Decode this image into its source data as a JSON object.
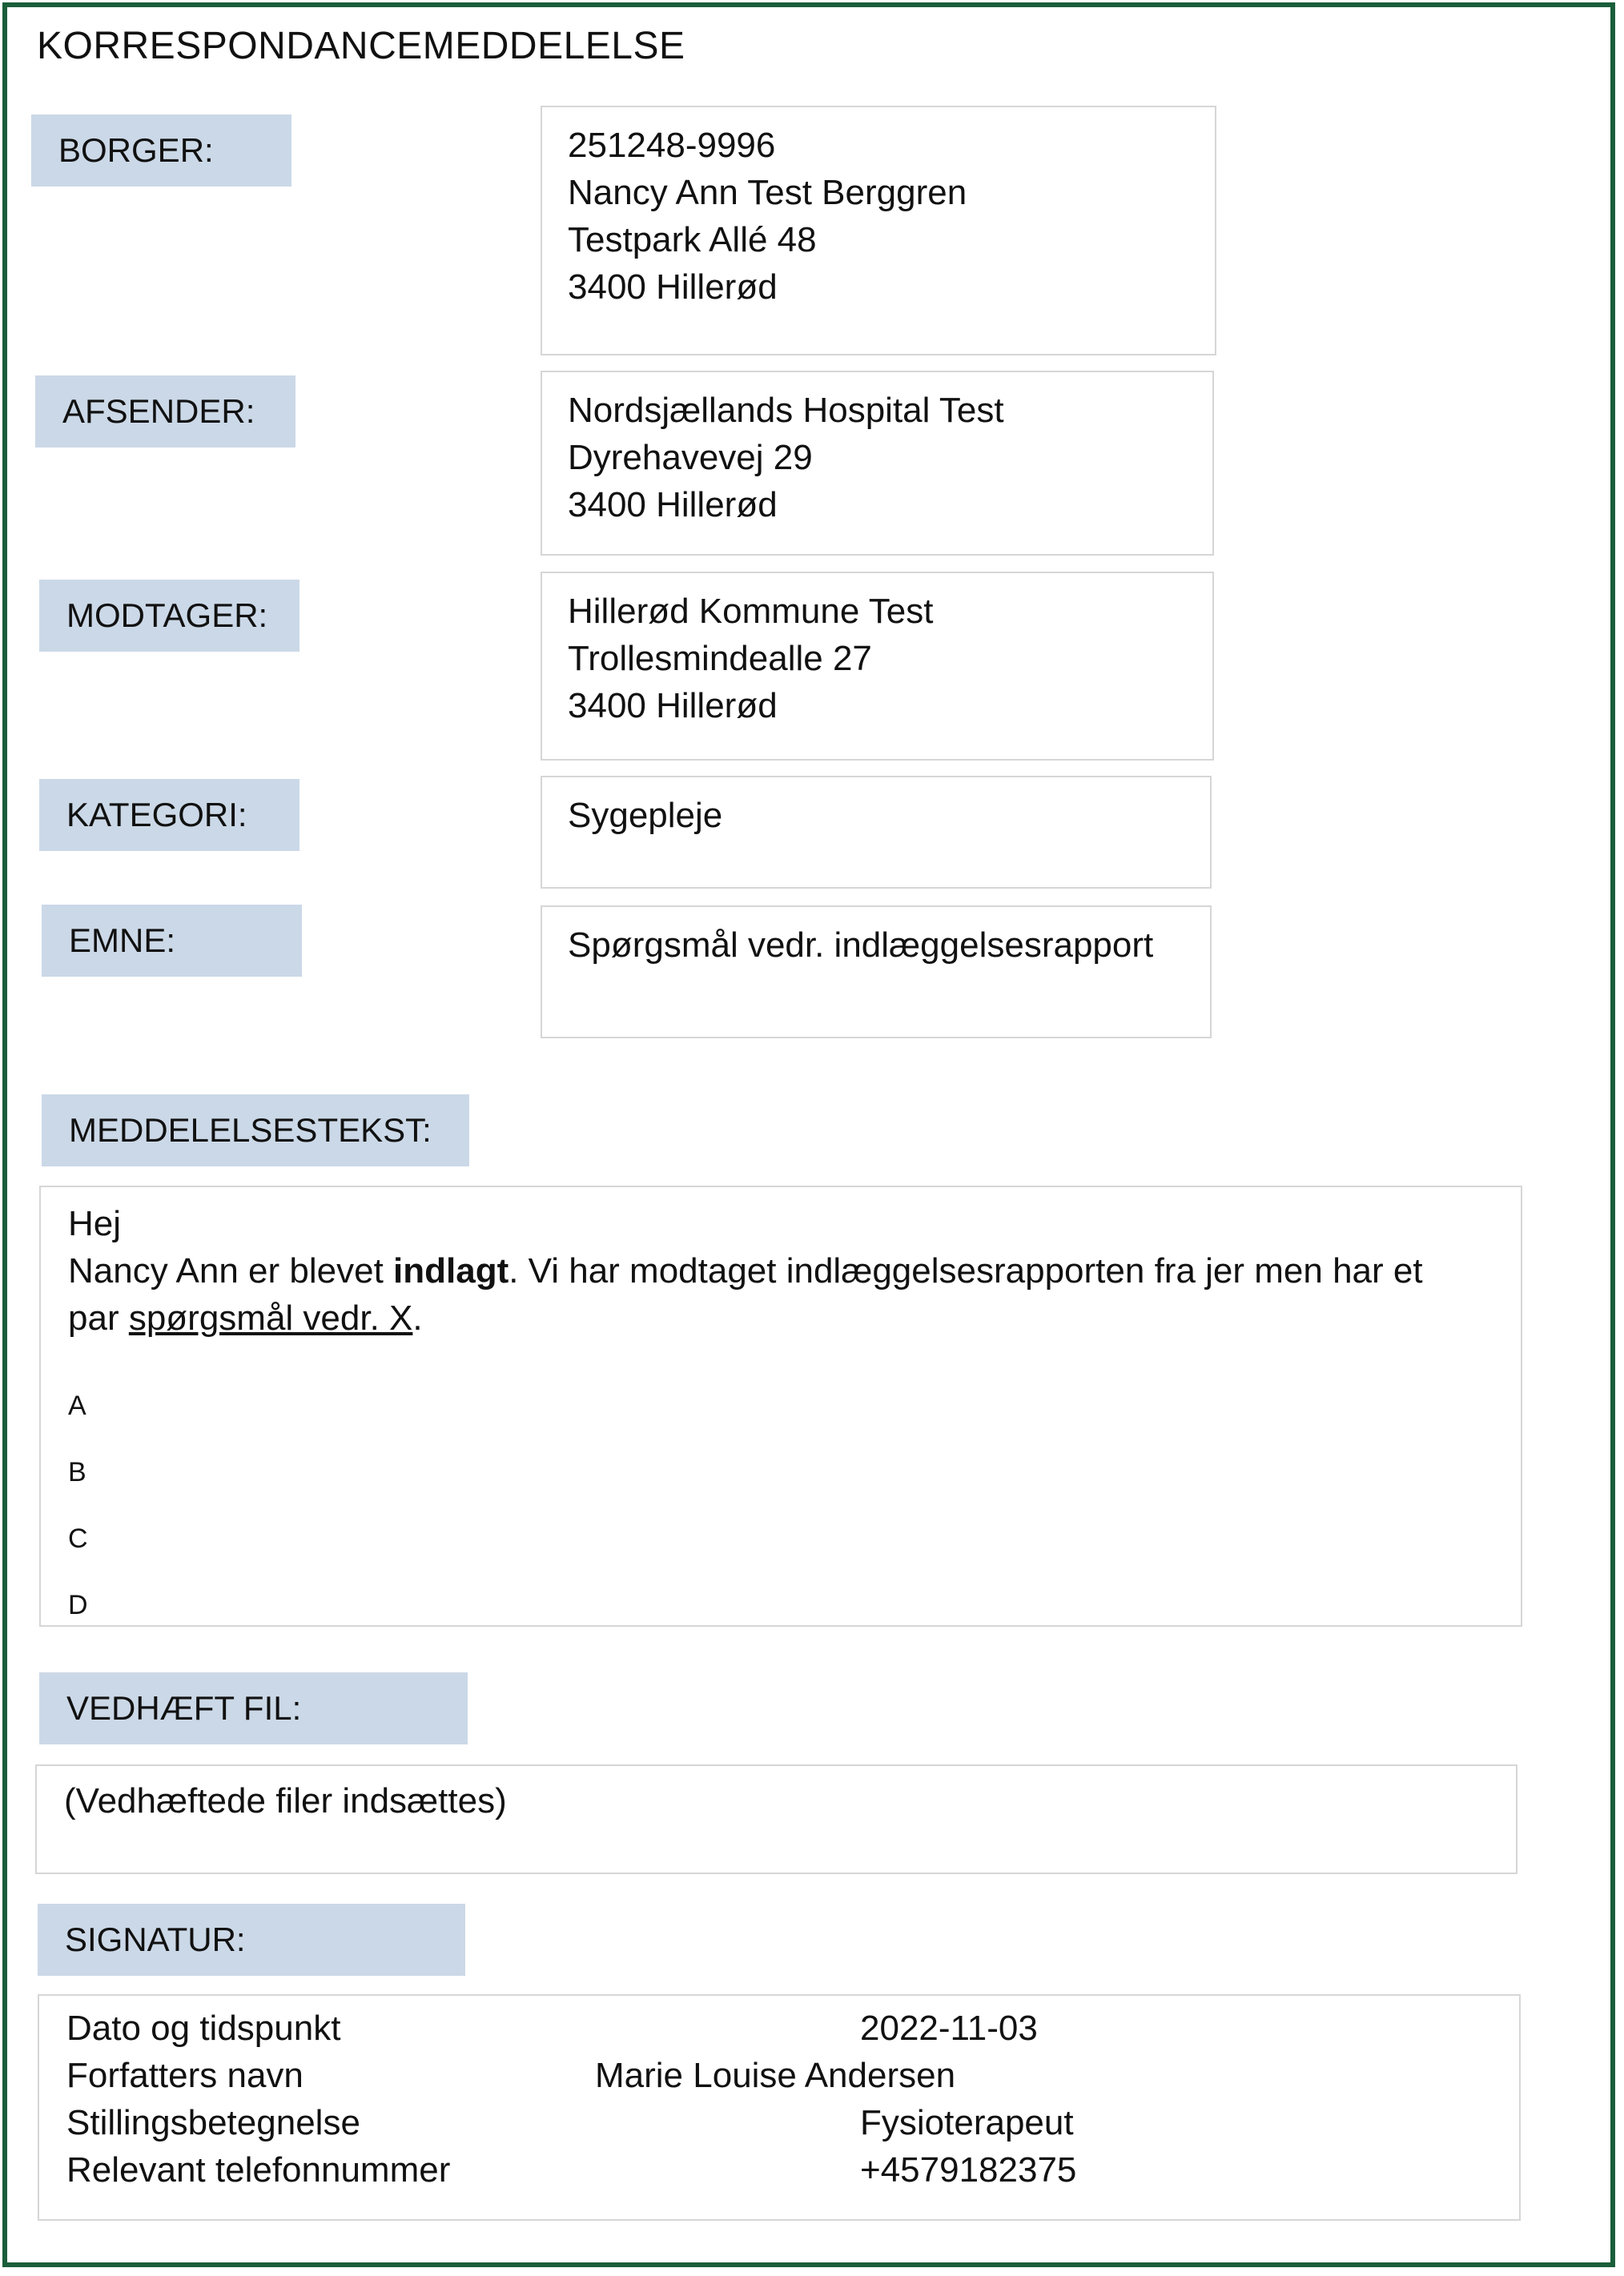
{
  "title": "KORRESPONDANCEMEDDELELSE",
  "borger": {
    "label": "BORGER:",
    "lines": [
      "251248-9996",
      "Nancy Ann Test Berggren",
      "Testpark Allé 48",
      "3400 Hillerød"
    ]
  },
  "afsender": {
    "label": "AFSENDER:",
    "lines": [
      "Nordsjællands Hospital Test",
      "Dyrehavevej 29",
      "3400 Hillerød"
    ]
  },
  "modtager": {
    "label": "MODTAGER:",
    "lines": [
      "Hillerød Kommune Test",
      "Trollesmindealle 27",
      "3400 Hillerød"
    ]
  },
  "kategori": {
    "label": "KATEGORI:",
    "value": "Sygepleje"
  },
  "emne": {
    "label": "EMNE:",
    "value": "Spørgsmål vedr. indlæggelsesrapport"
  },
  "meddelelse": {
    "label": "MEDDELELSESTEKST:",
    "greeting": "Hej",
    "body_pre": "Nancy Ann er blevet ",
    "body_bold": "indlagt",
    "body_mid": ". Vi har modtaget indlæggelsesrapporten fra jer men har et par ",
    "body_underlined": "spørgsmål vedr. X",
    "body_end": ".",
    "items": [
      "A",
      "B",
      "C",
      "D"
    ]
  },
  "vedhaeft": {
    "label": "VEDHÆFT FIL:",
    "value": "(Vedhæftede filer indsættes)"
  },
  "signatur": {
    "label": "SIGNATUR:",
    "rows": [
      {
        "label": "Dato og tidspunkt",
        "value": "2022-11-03"
      },
      {
        "label": "Forfatters navn",
        "value": "Marie Louise Andersen"
      },
      {
        "label": "Stillingsbetegnelse",
        "value": "Fysioterapeut"
      },
      {
        "label": "Relevant telefonnummer",
        "value": "+4579182375"
      }
    ]
  },
  "colors": {
    "frame": "#1a5e3a",
    "label_bg": "#cbd8e7",
    "box_border": "#d6d6d6"
  }
}
